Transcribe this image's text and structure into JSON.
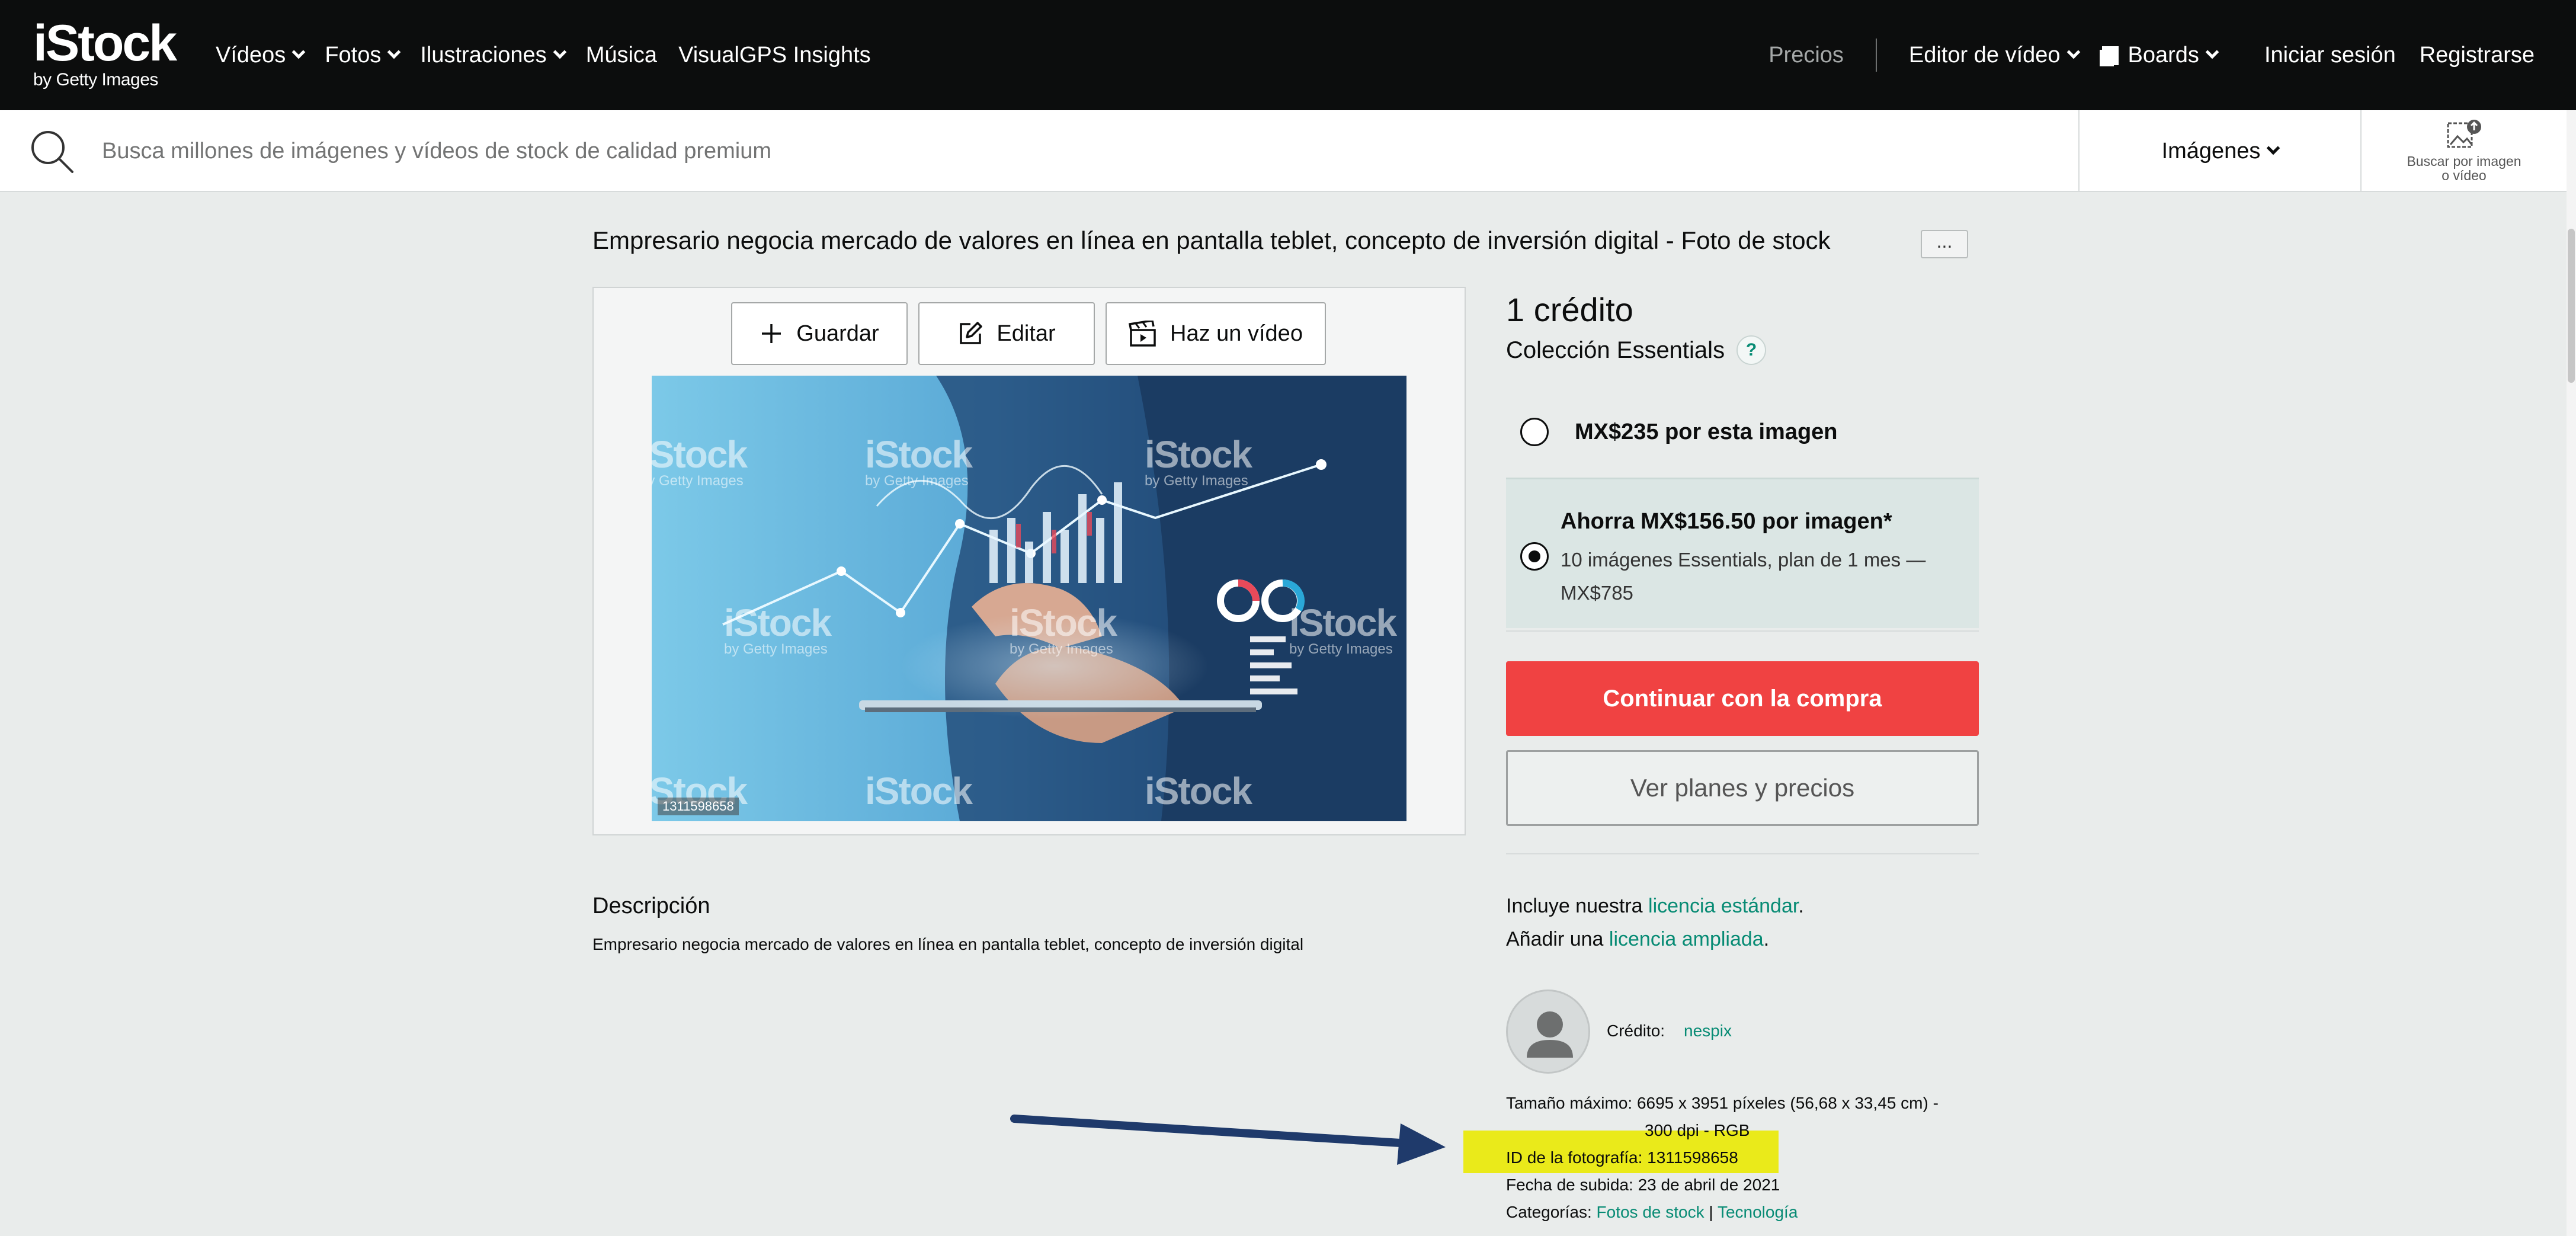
{
  "brand": {
    "name": "iStock",
    "sub": "by Getty Images"
  },
  "nav": {
    "left": [
      {
        "label": "Vídeos",
        "dropdown": true
      },
      {
        "label": "Fotos",
        "dropdown": true
      },
      {
        "label": "Ilustraciones",
        "dropdown": true
      },
      {
        "label": "Música",
        "dropdown": false
      },
      {
        "label": "VisualGPS Insights",
        "dropdown": false
      }
    ],
    "pricing": "Precios",
    "video_editor": "Editor de vídeo",
    "boards": "Boards",
    "sign_in": "Iniciar sesión",
    "register": "Registrarse"
  },
  "search": {
    "placeholder": "Busca millones de imágenes y vídeos de stock de calidad premium",
    "type": "Imágenes",
    "visual_search_label_1": "Buscar por imagen",
    "visual_search_label_2": "o vídeo"
  },
  "asset": {
    "title": "Empresario negocia mercado de valores en línea en pantalla teblet, concepto de inversión digital - Foto de stock",
    "more": "...",
    "tools": {
      "save": "Guardar",
      "edit": "Editar",
      "make_video": "Haz un vídeo"
    },
    "photo_id_overlay": "1311598658",
    "watermark": "iStock",
    "watermark_sub": "by Getty Images"
  },
  "purchase": {
    "credits": "1 crédito",
    "collection": "Colección Essentials",
    "help": "?",
    "option1": "MX$235 por esta imagen",
    "option2_title": "Ahorra MX$156.50 por imagen*",
    "option2_sub": "10 imágenes Essentials, plan de 1 mes — MX$785",
    "buy": "Continuar con la compra",
    "plans": "Ver planes y precios"
  },
  "description": {
    "heading": "Descripción",
    "text": "Empresario negocia mercado de valores en línea en pantalla teblet, concepto de inversión digital"
  },
  "license": {
    "line1_pre": "Incluye nuestra ",
    "line1_link": "licencia estándar",
    "line1_post": ".",
    "line2_pre": "Añadir una ",
    "line2_link": "licencia ampliada",
    "line2_post": "."
  },
  "details": {
    "credit_label": "Crédito:",
    "credit_name": "nespix",
    "max_size": "Tamaño máximo: 6695 x 3951 píxeles (56,68 x 33,45 cm) -",
    "max_size_cont": "300 dpi - RGB",
    "photo_id": "ID de la fotografía: 1311598658",
    "upload_date": "Fecha de subida: 23 de abril de 2021",
    "categories_label": "Categorías: ",
    "category1": "Fotos de stock",
    "category_sep": " | ",
    "category2": "Tecnología"
  },
  "colors": {
    "topbar": "#0c0d0d",
    "accent": "#078b74",
    "buy": "#f04242",
    "highlight": "#eaea1a",
    "annotation_arrow": "#1f3a6b"
  }
}
